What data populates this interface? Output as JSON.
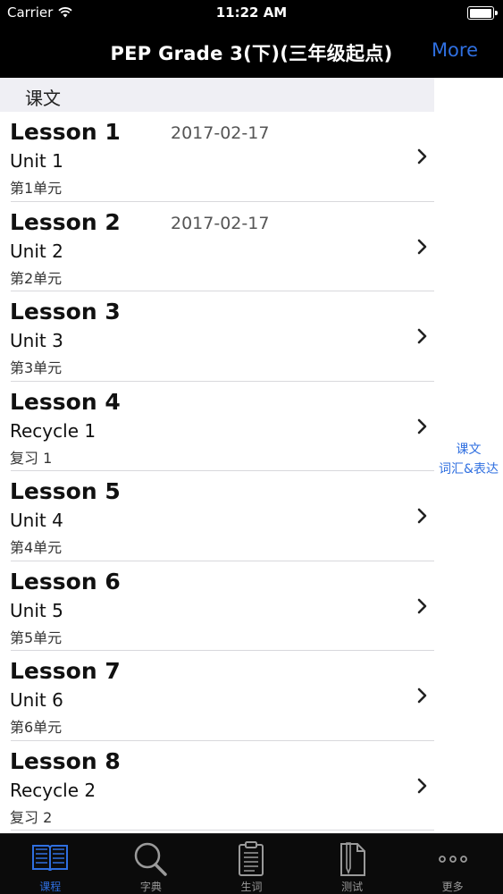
{
  "status_bar": {
    "carrier": "Carrier",
    "time": "11:22 AM"
  },
  "nav": {
    "title": "PEP Grade 3(下)(三年级起点)",
    "more_label": "More"
  },
  "section": {
    "header": "课文"
  },
  "lessons": [
    {
      "title": "Lesson 1",
      "date": "2017-02-17",
      "unit": "Unit 1",
      "cn": "第1单元"
    },
    {
      "title": "Lesson 2",
      "date": "2017-02-17",
      "unit": "Unit 2",
      "cn": "第2单元"
    },
    {
      "title": "Lesson 3",
      "date": "",
      "unit": "Unit 3",
      "cn": "第3单元"
    },
    {
      "title": "Lesson 4",
      "date": "",
      "unit": "Recycle 1",
      "cn": "复习 1"
    },
    {
      "title": "Lesson 5",
      "date": "",
      "unit": "Unit 4",
      "cn": "第4单元"
    },
    {
      "title": "Lesson 6",
      "date": "",
      "unit": "Unit 5",
      "cn": "第5单元"
    },
    {
      "title": "Lesson 7",
      "date": "",
      "unit": "Unit 6",
      "cn": "第6单元"
    },
    {
      "title": "Lesson 8",
      "date": "",
      "unit": "Recycle 2",
      "cn": "复习 2"
    }
  ],
  "side_index": [
    "课文",
    "词汇&表达"
  ],
  "tabs": [
    {
      "label": "课程",
      "icon": "book-icon",
      "active": true
    },
    {
      "label": "字典",
      "icon": "magnifier-icon",
      "active": false
    },
    {
      "label": "生词",
      "icon": "clipboard-icon",
      "active": false
    },
    {
      "label": "测试",
      "icon": "pen-paper-icon",
      "active": false
    },
    {
      "label": "更多",
      "icon": "more-dots-icon",
      "active": false
    }
  ],
  "colors": {
    "accent": "#2f6fe0",
    "bar_background": "#000000",
    "section_background": "#efeff4"
  }
}
